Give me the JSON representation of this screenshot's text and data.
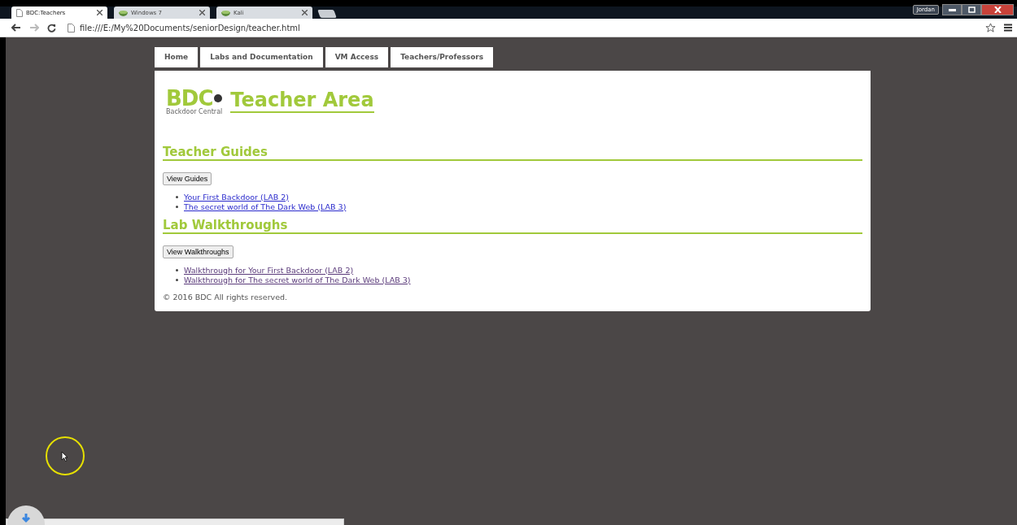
{
  "browser": {
    "tabs": [
      {
        "title": "BDC:Teachers",
        "selected": true,
        "kind": "page"
      },
      {
        "title": "Windows 7",
        "selected": false,
        "kind": "vm"
      },
      {
        "title": "Kali",
        "selected": false,
        "kind": "vm"
      }
    ],
    "user": "Jordan",
    "address": "file:///E:/My%20Documents/seniorDesign/teacher.html"
  },
  "nav": [
    {
      "label": "Home",
      "selected": false
    },
    {
      "label": "Labs and Documentation",
      "selected": false
    },
    {
      "label": "VM Access",
      "selected": false
    },
    {
      "label": "Teachers/Professors",
      "selected": false
    }
  ],
  "logo": {
    "letters": "BDC",
    "tagline": "Backdoor Central"
  },
  "title": "Teacher Area",
  "sections": [
    {
      "heading": "Teacher Guides",
      "button": "View Guides",
      "links": [
        {
          "text": "Your First Backdoor (LAB 2)",
          "visited": false
        },
        {
          "text": "The secret world of The Dark Web (LAB 3)",
          "visited": false
        }
      ]
    },
    {
      "heading": "Lab Walkthroughs",
      "button": "View Walkthroughs",
      "links": [
        {
          "text": "Walkthrough for Your First Backdoor (LAB 2)",
          "visited": true
        },
        {
          "text": "Walkthrough for The secret world of The Dark Web (LAB 3)",
          "visited": true
        }
      ]
    }
  ],
  "footer": "© 2016 BDC All rights reserved."
}
